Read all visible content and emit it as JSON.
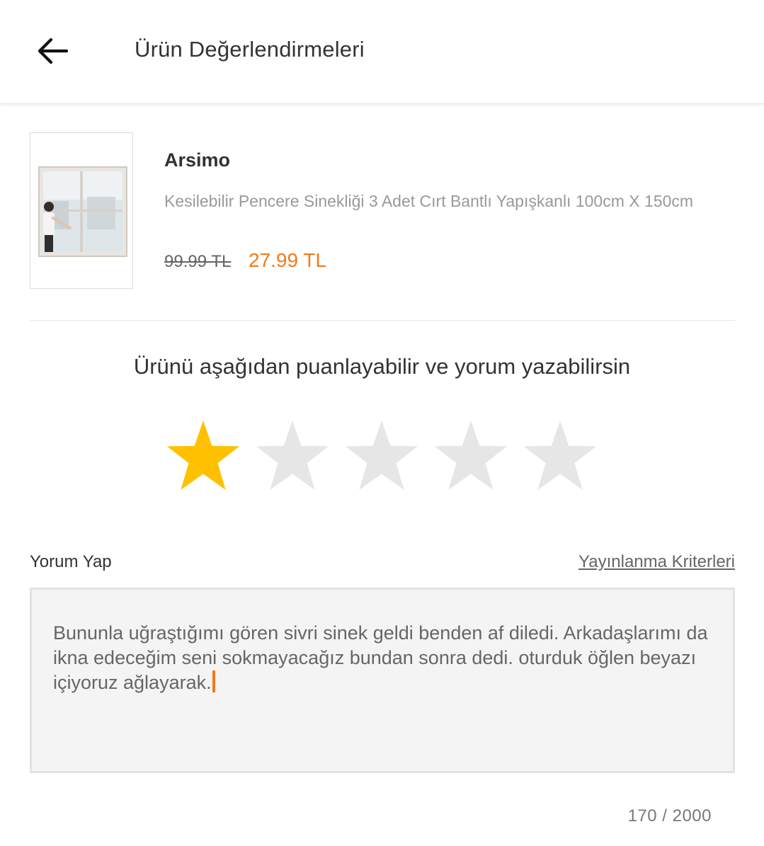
{
  "header": {
    "title": "Ürün Değerlendirmeleri",
    "back_icon": "arrow-left-icon"
  },
  "product": {
    "brand": "Arsimo",
    "name": "Kesilebilir Pencere Sinekliği 3 Adet Cırt Bantlı Yapışkanlı 100cm X 150cm",
    "old_price": "99.99 TL",
    "new_price": "27.99 TL"
  },
  "rating": {
    "prompt": "Ürünü aşağıdan puanlayabilir ve yorum yazabilirsin",
    "value": 1,
    "max": 5,
    "active_color": "#FFC000",
    "inactive_color": "#E6E6E6"
  },
  "comment": {
    "label": "Yorum Yap",
    "criteria_link": "Yayınlanma Kriterleri",
    "text": "Bununla uğraştığımı gören sivri sinek geldi benden af diledi. Arkadaşlarımı da ikna edeceğim seni sokmayacağız bundan sonra dedi. oturduk öğlen beyazı içiyoruz ağlayarak.",
    "char_count": "170 / 2000"
  },
  "colors": {
    "accent": "#F27A1A"
  }
}
